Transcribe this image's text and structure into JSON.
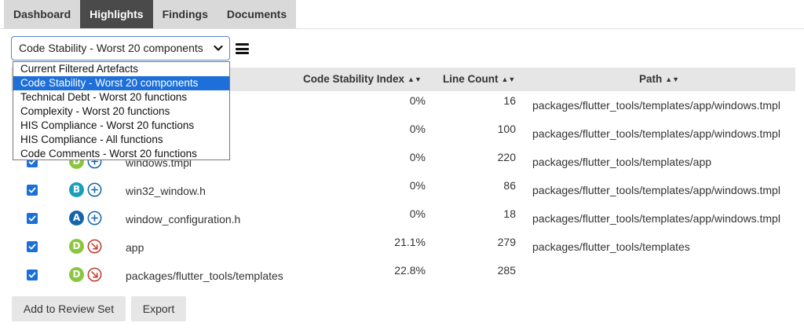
{
  "tabs": [
    {
      "label": "Dashboard",
      "active": false
    },
    {
      "label": "Highlights",
      "active": true
    },
    {
      "label": "Findings",
      "active": false
    },
    {
      "label": "Documents",
      "active": false
    }
  ],
  "filter": {
    "selected": "Code Stability - Worst 20 components",
    "options": [
      "Current Filtered Artefacts",
      "Code Stability - Worst 20 components",
      "Technical Debt - Worst 20 functions",
      "Complexity - Worst 20 functions",
      "HIS Compliance - Worst 20 functions",
      "HIS Compliance - All functions",
      "Code Comments - Worst 20 functions"
    ],
    "selected_index": 1
  },
  "table": {
    "columns": {
      "stability": "Code Stability Index",
      "lines": "Line Count",
      "path": "Path"
    },
    "rows": [
      {
        "checked": true,
        "rating": "",
        "trend": "",
        "name": "",
        "stability": "0%",
        "lines": "16",
        "path": "packages/flutter_tools/templates/app/windows.tmpl"
      },
      {
        "checked": true,
        "rating": "",
        "trend": "",
        "name": "",
        "stability": "0%",
        "lines": "100",
        "path": "packages/flutter_tools/templates/app/windows.tmpl"
      },
      {
        "checked": true,
        "rating": "D",
        "trend": "new",
        "name": "windows.tmpl",
        "stability": "0%",
        "lines": "220",
        "path": "packages/flutter_tools/templates/app"
      },
      {
        "checked": true,
        "rating": "B",
        "trend": "new",
        "name": "win32_window.h",
        "stability": "0%",
        "lines": "86",
        "path": "packages/flutter_tools/templates/app/windows.tmpl"
      },
      {
        "checked": true,
        "rating": "A",
        "trend": "new",
        "name": "window_configuration.h",
        "stability": "0%",
        "lines": "18",
        "path": "packages/flutter_tools/templates/app/windows.tmpl"
      },
      {
        "checked": true,
        "rating": "D",
        "trend": "degraded",
        "name": "app",
        "stability": "21.1%",
        "lines": "279",
        "path": "packages/flutter_tools/templates"
      },
      {
        "checked": true,
        "rating": "D",
        "trend": "degraded",
        "name": "packages/flutter_tools/templates",
        "stability": "22.8%",
        "lines": "285",
        "path": ""
      }
    ]
  },
  "buttons": {
    "add_to_review": "Add to Review Set",
    "export": "Export"
  },
  "colors": {
    "rating_A": "#1565a8",
    "rating_B": "#1b9fb8",
    "rating_D": "#8cc63f",
    "trend_new": "#1565a8",
    "trend_degraded": "#c0392b",
    "checkbox": "#1b6fd9",
    "selected_option": "#1e6fd9"
  },
  "icons": {
    "select_chevron": "chevron-down-icon",
    "menu": "hamburger-menu-icon",
    "trend_new": "plus-circle-icon",
    "trend_degraded": "arrow-down-right-circle-icon",
    "sort": "sort-both-icon"
  }
}
